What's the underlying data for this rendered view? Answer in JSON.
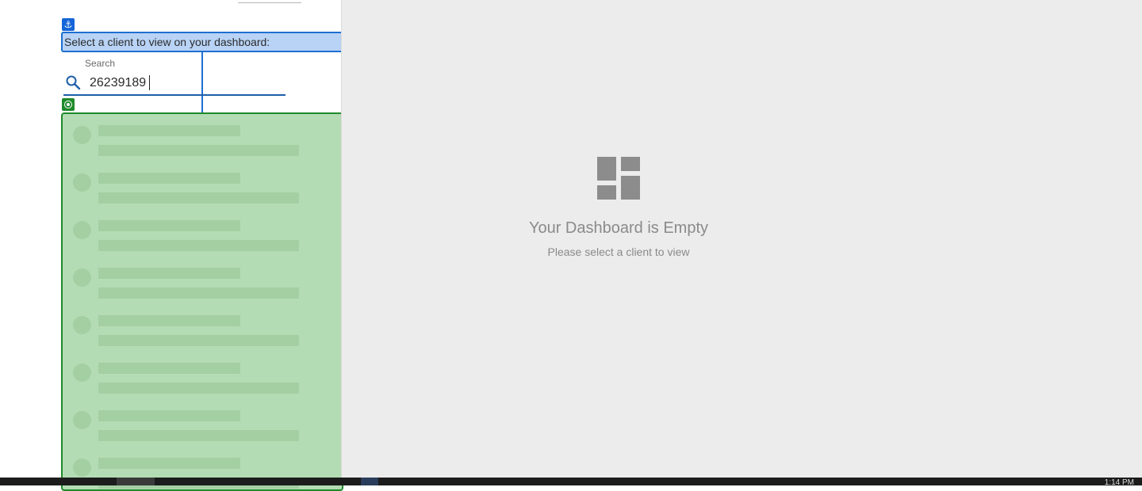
{
  "client_selector": {
    "label": "Select a client to view on your dashboard:",
    "anchor_icon": "⚓"
  },
  "search": {
    "caption": "Search",
    "value": "26239189",
    "icon": "search-icon"
  },
  "results": {
    "state": "loading",
    "placeholder_rows": 8
  },
  "dashboard": {
    "empty_title": "Your Dashboard is Empty",
    "empty_subtitle": "Please select a client to view",
    "icon": "dashboard-icon"
  },
  "taskbar": {
    "clock": "1:14 PM"
  },
  "colors": {
    "accent_blue": "#1f6fd1",
    "highlight_green": "#1f8a2a",
    "empty_bg": "#ececec",
    "muted_text": "#8a8a8a"
  }
}
